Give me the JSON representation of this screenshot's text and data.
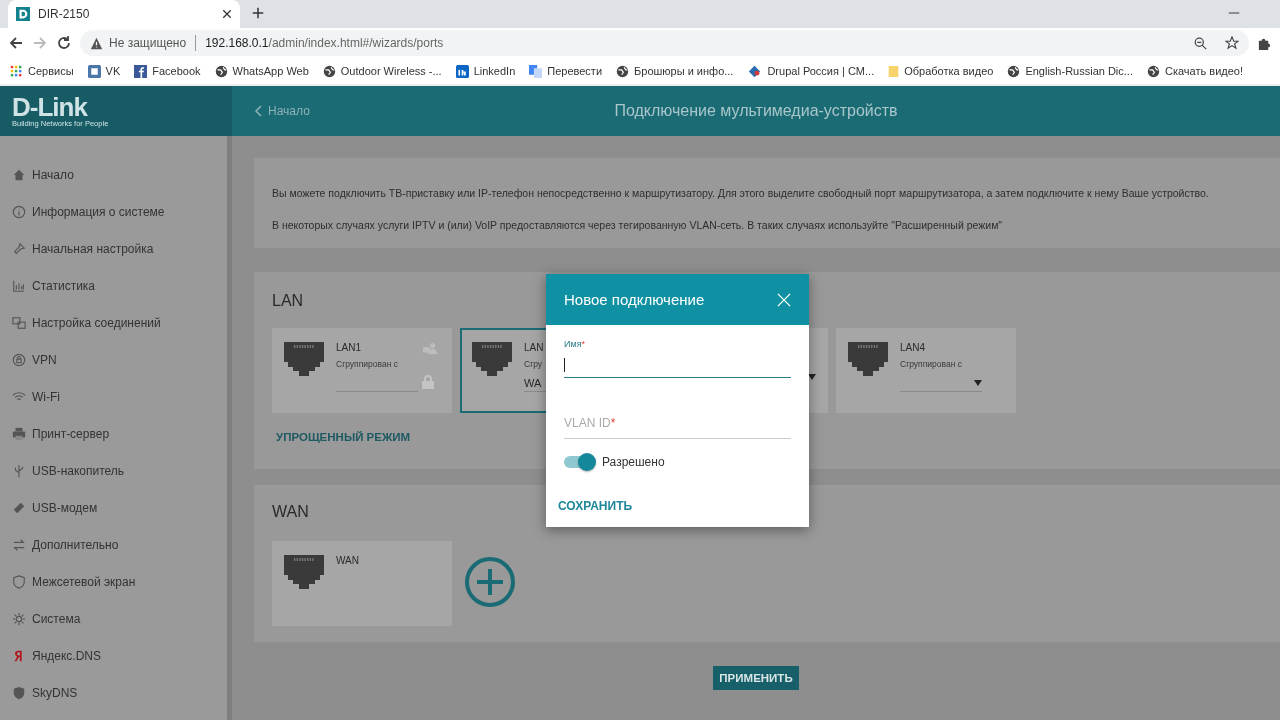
{
  "browser": {
    "tab_title": "DIR-2150",
    "url_warning": "Не защищено",
    "url_host": "192.168.0.1",
    "url_path": "/admin/index.html#/wizards/ports",
    "bookmarks": [
      "Сервисы",
      "VK",
      "Facebook",
      "WhatsApp Web",
      "Outdoor Wireless -...",
      "LinkedIn",
      "Перевести",
      "Брошюры и инфо...",
      "Drupal Россия | CM...",
      "Обработка видео",
      "English-Russian Dic...",
      "Скачать видео!"
    ]
  },
  "header": {
    "logo": "D-Link",
    "logo_tagline": "Building Networks for People",
    "back": "Начало",
    "title": "Подключение мультимедиа-устройств"
  },
  "sidebar": {
    "items": [
      "Начало",
      "Информация о системе",
      "Начальная настройка",
      "Статистика",
      "Настройка соединений",
      "VPN",
      "Wi-Fi",
      "Принт-сервер",
      "USB-накопитель",
      "USB-модем",
      "Дополнительно",
      "Межсетевой экран",
      "Система",
      "Яндекс.DNS",
      "SkyDNS"
    ]
  },
  "intro": [
    "Вы можете подключить ТВ-приставку или IP-телефон непосредственно к маршрутизатору. Для этого выделите свободный порт маршрутизатора, а затем подключите к нему Ваше устройство.",
    "В некоторых случаях услуги IPTV и (или) VoIP предоставляются через тегированную VLAN-сеть. В таких случаях используйте \"Расширенный режим\""
  ],
  "lan": {
    "title": "LAN",
    "ports": [
      {
        "name": "LAN1",
        "subtitle": "Сгруппирован с",
        "selected": false,
        "locked": true
      },
      {
        "name": "LAN",
        "subtitle": "Сгру",
        "value": "WA",
        "selected": true,
        "locked": false
      },
      {
        "selected": false,
        "locked": false
      },
      {
        "name": "LAN4",
        "subtitle": "Сгруппирован с",
        "selected": false,
        "locked": false
      }
    ],
    "mode_link": "УПРОЩЕННЫЙ РЕЖИМ"
  },
  "wan": {
    "title": "WAN",
    "ports": [
      {
        "name": "WAN",
        "selected": false,
        "locked": false
      }
    ]
  },
  "apply_button": "ПРИМЕНИТЬ",
  "dialog": {
    "title": "Новое подключение",
    "fields": [
      {
        "label": "Имя",
        "required_mark": "*",
        "focused": true
      },
      {
        "label": "VLAN ID",
        "required_mark": "*",
        "focused": false
      }
    ],
    "toggle": {
      "label": "Разрешено",
      "on": true
    },
    "save": "СОХРАНИТЬ"
  }
}
